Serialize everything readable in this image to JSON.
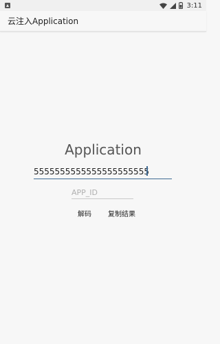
{
  "status_bar": {
    "time": "3:11"
  },
  "app_bar": {
    "title": "云注入Application"
  },
  "main": {
    "heading": "Application",
    "input_value": "5555555555555555555555",
    "appid_placeholder": "APP_ID",
    "appid_value": "",
    "decode_label": "解码",
    "copy_label": "复制结果"
  },
  "colors": {
    "accent": "#3e6a93",
    "background": "#f7f7f7"
  }
}
